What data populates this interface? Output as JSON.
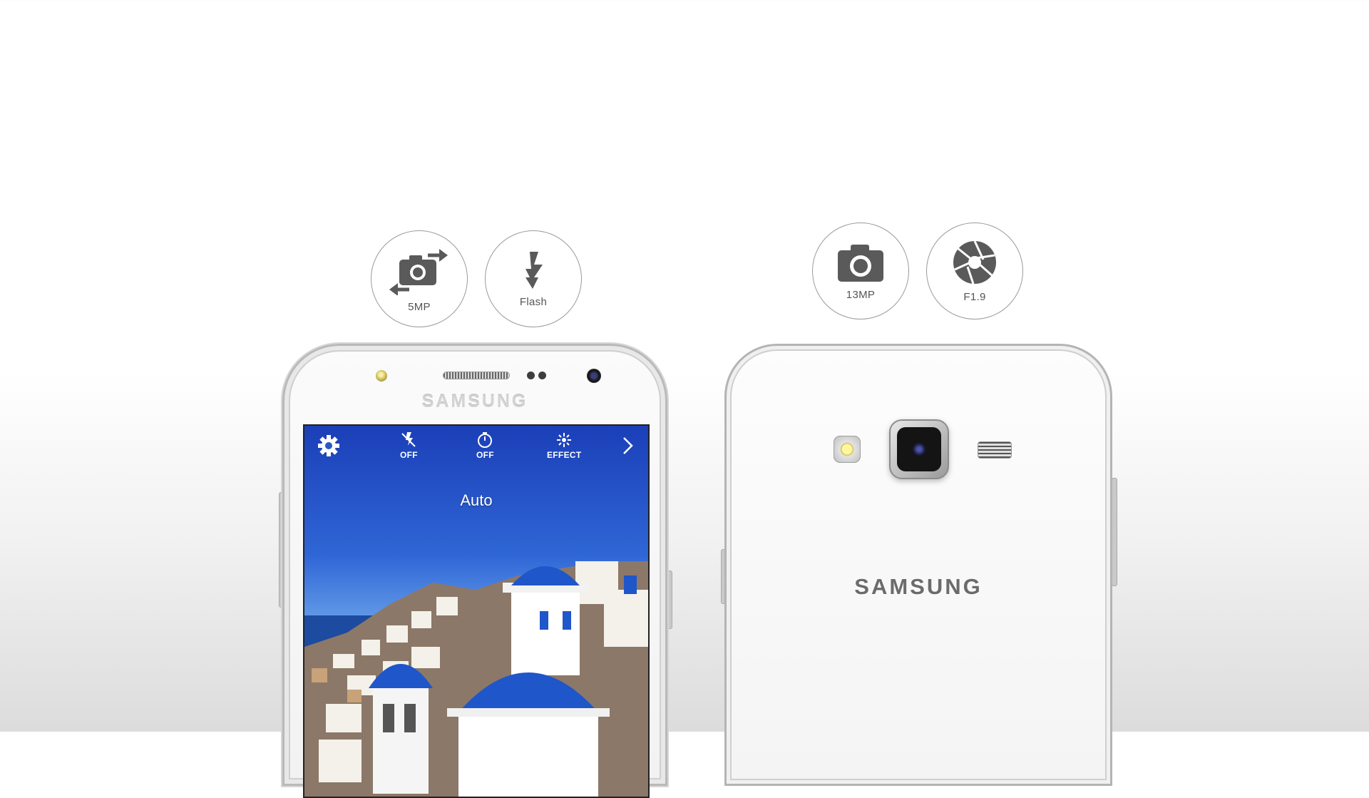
{
  "front_badges": [
    {
      "label": "5MP",
      "icon": "front-camera-switch-icon"
    },
    {
      "label": "Flash",
      "icon": "flash-icon"
    }
  ],
  "rear_badges": [
    {
      "label": "13MP",
      "icon": "camera-icon"
    },
    {
      "label": "F1.9",
      "icon": "aperture-icon"
    }
  ],
  "front_phone": {
    "brand": "SAMSUNG",
    "camera_ui": {
      "settings_icon": "gear-icon",
      "flash_label": "OFF",
      "timer_label": "OFF",
      "effect_label": "EFFECT",
      "next_icon": "chevron-right-icon",
      "mode_label": "Auto"
    }
  },
  "back_phone": {
    "brand": "SAMSUNG"
  },
  "colors": {
    "screen_sky": "#2f66d6",
    "dome_blue": "#1f56c9"
  }
}
